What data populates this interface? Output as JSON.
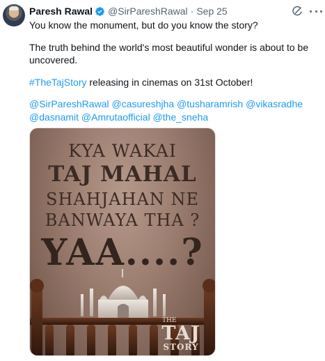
{
  "author": {
    "name": "Paresh Rawal",
    "handle": "@SirPareshRawal",
    "separator": "·",
    "date": "Sep 25"
  },
  "body": {
    "line1": "You know the monument, but do you know the story?",
    "line2": "The truth behind the world's most beautiful wonder is about to be uncovered.",
    "hashtag": "#TheTajStory",
    "line3_rest": " releasing in cinemas on 31st October!",
    "mentions": [
      "@SirPareshRawal",
      "@casureshjha",
      "@tusharamrish",
      "@vikasradhe",
      "@dasnamit",
      "@Amrutaofficial",
      "@the_sneha"
    ]
  },
  "poster": {
    "line1": "KYA WAKAI",
    "line2": "TAJ MAHAL",
    "line3": "SHAHJAHAN NE",
    "line4": "BANWAYA THA ?",
    "line5": "YAA....?",
    "logo_the": "THE",
    "logo_taj": "TAJ",
    "logo_story": "STORY"
  },
  "icons": [
    "verified-badge-icon",
    "grok-icon",
    "more-options-icon"
  ],
  "colors": {
    "text": "#0f1419",
    "muted": "#536471",
    "link": "#1d9bf0",
    "verified": "#1d9bf0",
    "poster_bg": "#9d7f71",
    "poster_text": "#3b2b24"
  }
}
